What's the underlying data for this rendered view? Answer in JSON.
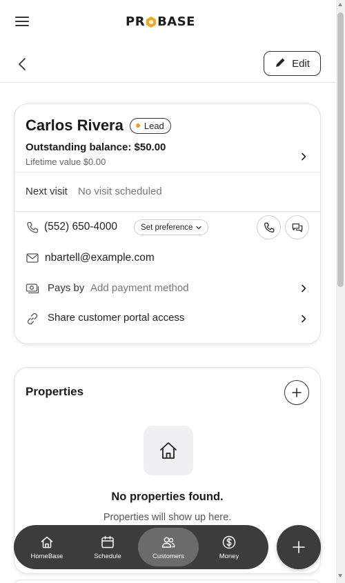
{
  "app": {
    "logo_left": "PR",
    "logo_right": "BASE"
  },
  "header": {
    "edit_label": "Edit"
  },
  "customer": {
    "name": "Carlos Rivera",
    "status_badge": "Lead",
    "outstanding_balance": "Outstanding balance: $50.00",
    "lifetime_value": "Lifetime value $0.00",
    "next_visit_label": "Next visit",
    "next_visit_value": "No visit scheduled",
    "phone": "(552) 650-4000",
    "set_preference_label": "Set preference",
    "email": "nbartell@example.com",
    "pays_by_label": "Pays by",
    "pays_by_value": "Add payment method",
    "portal_label": "Share customer portal access"
  },
  "properties": {
    "title": "Properties",
    "empty_title": "No properties found.",
    "empty_subtitle": "Properties will show up here."
  },
  "bottom_nav": {
    "items": [
      {
        "label": "HomeBase",
        "icon": "home-icon",
        "active": false
      },
      {
        "label": "Schedule",
        "icon": "calendar-icon",
        "active": false
      },
      {
        "label": "Customers",
        "icon": "users-icon",
        "active": true
      },
      {
        "label": "Money",
        "icon": "dollar-icon",
        "active": false
      }
    ]
  },
  "colors": {
    "lead_dot": "#f0a020",
    "logo_hex": "#f5a623",
    "nav_bg": "#3c3c3c",
    "nav_active": "#6b6b6b"
  }
}
